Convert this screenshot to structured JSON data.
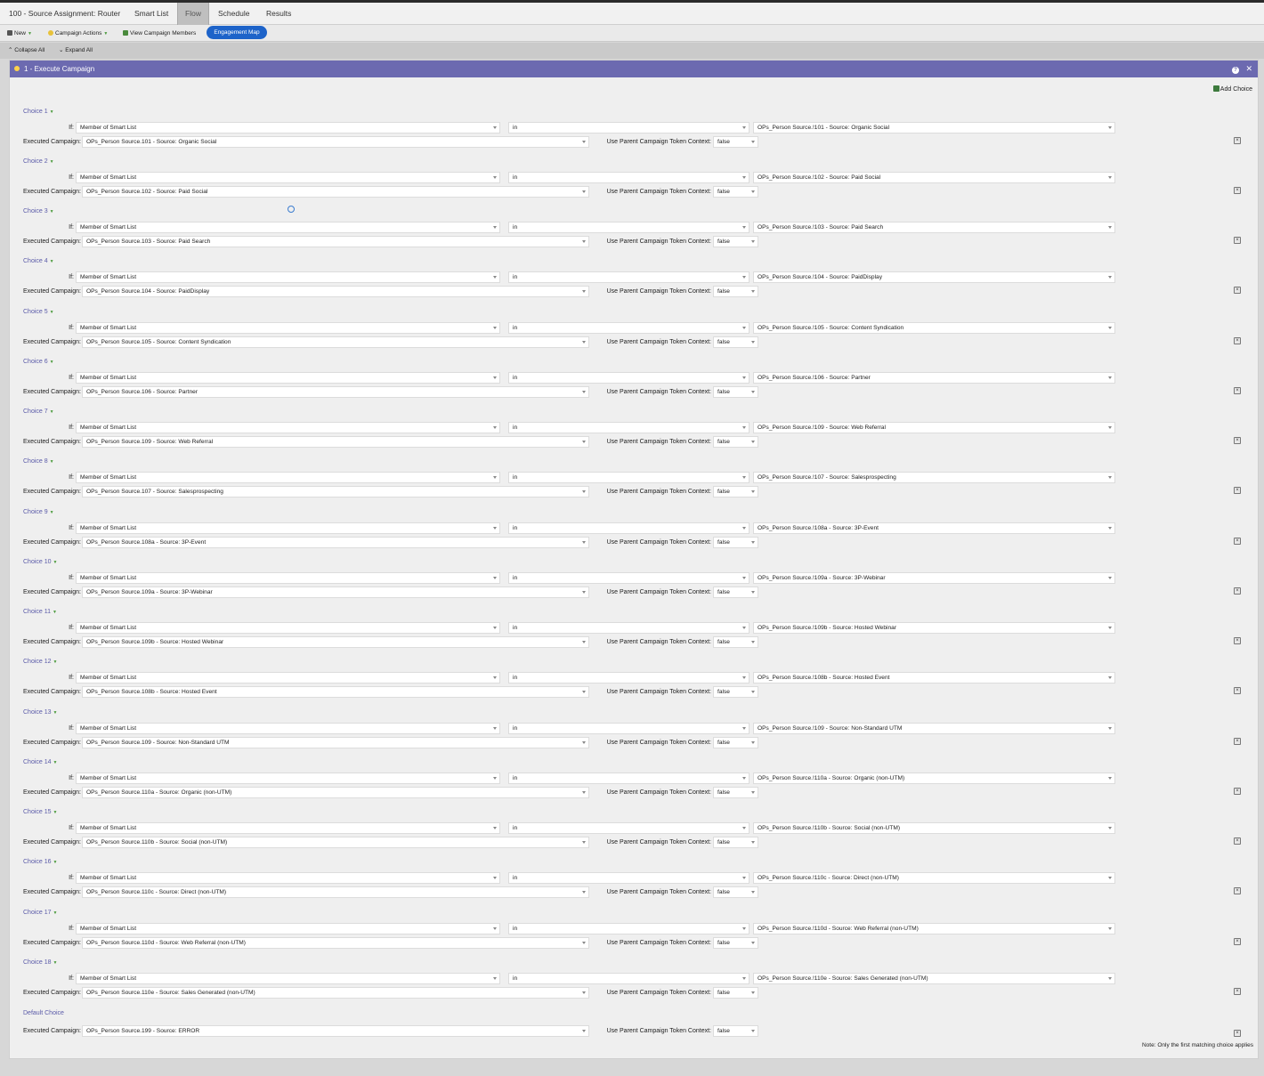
{
  "tabs": [
    {
      "label": "100 - Source Assignment: Router",
      "active": false
    },
    {
      "label": "Smart List",
      "active": false
    },
    {
      "label": "Flow",
      "active": true
    },
    {
      "label": "Schedule",
      "active": false
    },
    {
      "label": "Results",
      "active": false
    }
  ],
  "toolbar": {
    "new_label": "New",
    "campaign_actions_label": "Campaign Actions",
    "view_members_label": "View Campaign Members",
    "engagement_map_label": "Engagement Map"
  },
  "subbar": {
    "collapse_label": "Collapse All",
    "expand_label": "Expand All"
  },
  "step": {
    "title": "1 - Execute Campaign",
    "help_icon": "help-icon",
    "close_icon": "close-icon",
    "add_choice_label": "Add Choice"
  },
  "labels": {
    "if": "If:",
    "executed_campaign": "Executed Campaign:",
    "token_context": "Use Parent Campaign Token Context:"
  },
  "choices": [
    {
      "label": "Choice 1",
      "condition": "Member of Smart List",
      "operator": "in",
      "list": "OPs_Person Source.!101 - Source: Organic Social",
      "campaign": "OPs_Person Source.101 - Source: Organic Social",
      "token": "false"
    },
    {
      "label": "Choice 2",
      "condition": "Member of Smart List",
      "operator": "in",
      "list": "OPs_Person Source.!102 - Source: Paid Social",
      "campaign": "OPs_Person Source.102 - Source: Paid Social",
      "token": "false"
    },
    {
      "label": "Choice 3",
      "condition": "Member of Smart List",
      "operator": "in",
      "list": "OPs_Person Source.!103 - Source: Paid Search",
      "campaign": "OPs_Person Source.103 - Source: Paid Search",
      "token": "false"
    },
    {
      "label": "Choice 4",
      "condition": "Member of Smart List",
      "operator": "in",
      "list": "OPs_Person Source.!104 - Source: PaidDisplay",
      "campaign": "OPs_Person Source.104 - Source: PaidDisplay",
      "token": "false"
    },
    {
      "label": "Choice 5",
      "condition": "Member of Smart List",
      "operator": "in",
      "list": "OPs_Person Source.!105 - Source: Content Syndication",
      "campaign": "OPs_Person Source.105 - Source: Content Syndication",
      "token": "false"
    },
    {
      "label": "Choice 6",
      "condition": "Member of Smart List",
      "operator": "in",
      "list": "OPs_Person Source.!106 - Source: Partner",
      "campaign": "OPs_Person Source.106 - Source: Partner",
      "token": "false"
    },
    {
      "label": "Choice 7",
      "condition": "Member of Smart List",
      "operator": "in",
      "list": "OPs_Person Source.!109 - Source: Web Referral",
      "campaign": "OPs_Person Source.109 - Source: Web Referral",
      "token": "false"
    },
    {
      "label": "Choice 8",
      "condition": "Member of Smart List",
      "operator": "in",
      "list": "OPs_Person Source.!107 - Source: Salesprospecting",
      "campaign": "OPs_Person Source.107 - Source: Salesprospecting",
      "token": "false"
    },
    {
      "label": "Choice 9",
      "condition": "Member of Smart List",
      "operator": "in",
      "list": "OPs_Person Source.!108a - Source: 3P-Event",
      "campaign": "OPs_Person Source.108a - Source: 3P-Event",
      "token": "false"
    },
    {
      "label": "Choice 10",
      "condition": "Member of Smart List",
      "operator": "in",
      "list": "OPs_Person Source.!109a - Source: 3P-Webinar",
      "campaign": "OPs_Person Source.109a - Source: 3P-Webinar",
      "token": "false"
    },
    {
      "label": "Choice 11",
      "condition": "Member of Smart List",
      "operator": "in",
      "list": "OPs_Person Source.!109b - Source: Hosted Webinar",
      "campaign": "OPs_Person Source.109b - Source: Hosted Webinar",
      "token": "false"
    },
    {
      "label": "Choice 12",
      "condition": "Member of Smart List",
      "operator": "in",
      "list": "OPs_Person Source.!108b - Source: Hosted Event",
      "campaign": "OPs_Person Source.108b - Source: Hosted Event",
      "token": "false"
    },
    {
      "label": "Choice 13",
      "condition": "Member of Smart List",
      "operator": "in",
      "list": "OPs_Person Source.!109 - Source: Non-Standard UTM",
      "campaign": "OPs_Person Source.109 - Source: Non-Standard UTM",
      "token": "false"
    },
    {
      "label": "Choice 14",
      "condition": "Member of Smart List",
      "operator": "in",
      "list": "OPs_Person Source.!110a - Source: Organic (non-UTM)",
      "campaign": "OPs_Person Source.110a - Source: Organic (non-UTM)",
      "token": "false"
    },
    {
      "label": "Choice 15",
      "condition": "Member of Smart List",
      "operator": "in",
      "list": "OPs_Person Source.!110b - Source: Social (non-UTM)",
      "campaign": "OPs_Person Source.110b - Source: Social (non-UTM)",
      "token": "false"
    },
    {
      "label": "Choice 16",
      "condition": "Member of Smart List",
      "operator": "in",
      "list": "OPs_Person Source.!110c - Source: Direct (non-UTM)",
      "campaign": "OPs_Person Source.110c - Source: Direct (non-UTM)",
      "token": "false"
    },
    {
      "label": "Choice 17",
      "condition": "Member of Smart List",
      "operator": "in",
      "list": "OPs_Person Source.!110d - Source: Web Referral (non-UTM)",
      "campaign": "OPs_Person Source.110d - Source: Web Referral (non-UTM)",
      "token": "false"
    },
    {
      "label": "Choice 18",
      "condition": "Member of Smart List",
      "operator": "in",
      "list": "OPs_Person Source.!110e - Source: Sales Generated (non-UTM)",
      "campaign": "OPs_Person Source.110e - Source: Sales Generated (non-UTM)",
      "token": "false"
    }
  ],
  "default_choice": {
    "label": "Default Choice",
    "campaign": "OPs_Person Source.199 - Source: ERROR",
    "token": "false"
  },
  "note": "Note: Only the first matching choice applies",
  "colors": {
    "header": "#6c6ab0",
    "pill": "#1d63c9",
    "choice_label": "#5a5aa8"
  }
}
